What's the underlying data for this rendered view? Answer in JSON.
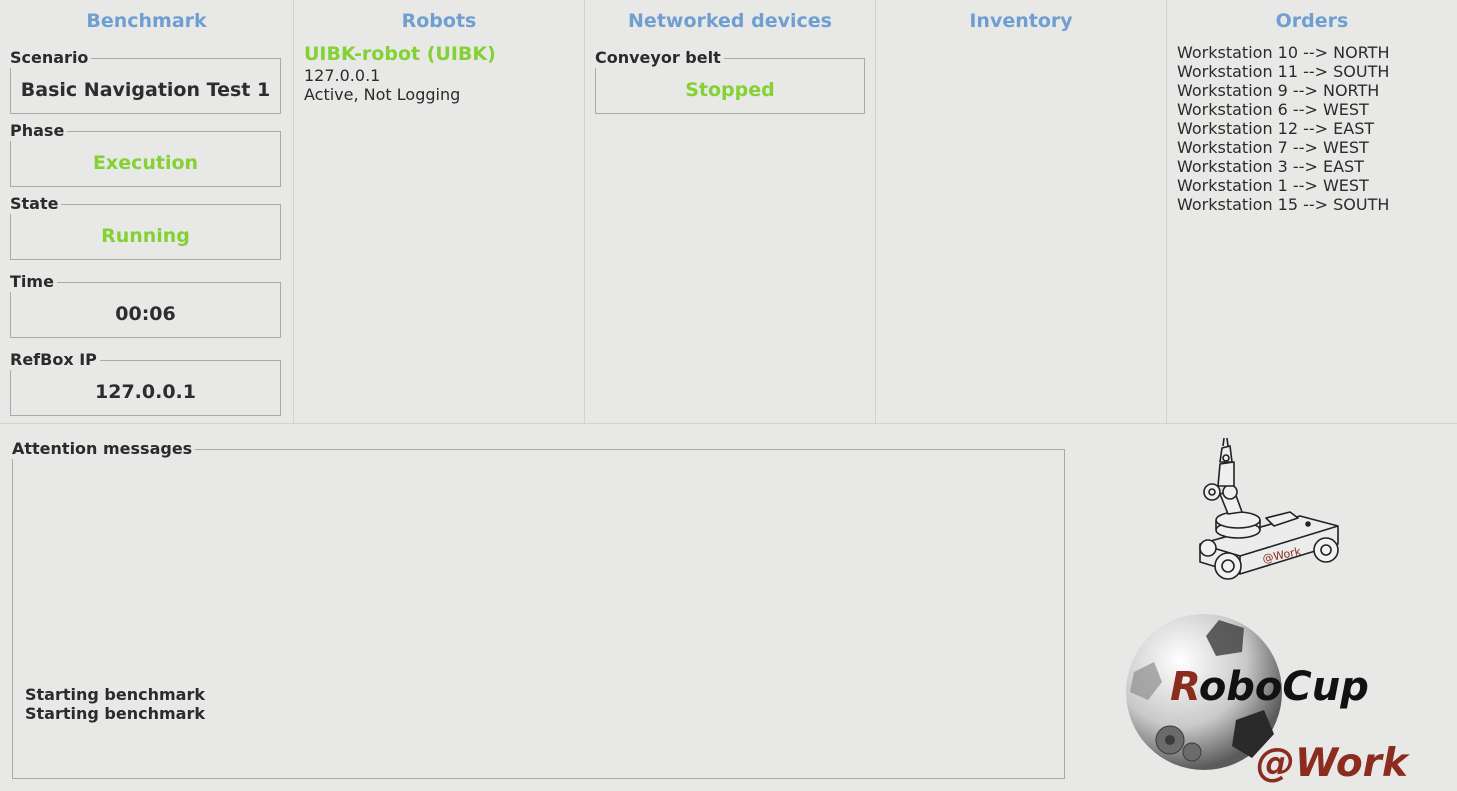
{
  "benchmark": {
    "title": "Benchmark",
    "fields": [
      {
        "label": "Scenario",
        "value": "Basic Navigation Test 1"
      },
      {
        "label": "Phase",
        "value": "Execution"
      },
      {
        "label": "State",
        "value": "Running"
      },
      {
        "label": "Time",
        "value": "00:06"
      },
      {
        "label": "RefBox IP",
        "value": "127.0.0.1"
      }
    ]
  },
  "robots": {
    "title": "Robots",
    "items": [
      {
        "name": "UIBK-robot (UIBK)",
        "ip": "127.0.0.1",
        "status": "Active, Not Logging"
      }
    ]
  },
  "networked_devices": {
    "title": "Networked devices",
    "devices": [
      {
        "label": "Conveyor belt",
        "value": "Stopped"
      }
    ]
  },
  "inventory": {
    "title": "Inventory"
  },
  "orders": {
    "title": "Orders",
    "items": [
      "Workstation 10 --> NORTH",
      "Workstation 11 --> SOUTH",
      "Workstation 9 --> NORTH",
      "Workstation 6 --> WEST",
      "Workstation 12 --> EAST",
      "Workstation 7 --> WEST",
      "Workstation 3 --> EAST",
      "Workstation 1 --> WEST",
      "Workstation 15 --> SOUTH"
    ]
  },
  "attention": {
    "label": "Attention messages",
    "messages": [
      "Starting benchmark",
      "Starting benchmark"
    ]
  },
  "logos": {
    "robot_badge": "@Work",
    "brand_r": "R",
    "brand_rest": "oboCup",
    "brand_sub": "@Work"
  },
  "colors": {
    "title_blue": "#6f9fd1",
    "status_green": "#84d133",
    "logo_red": "#8b2c1f"
  }
}
